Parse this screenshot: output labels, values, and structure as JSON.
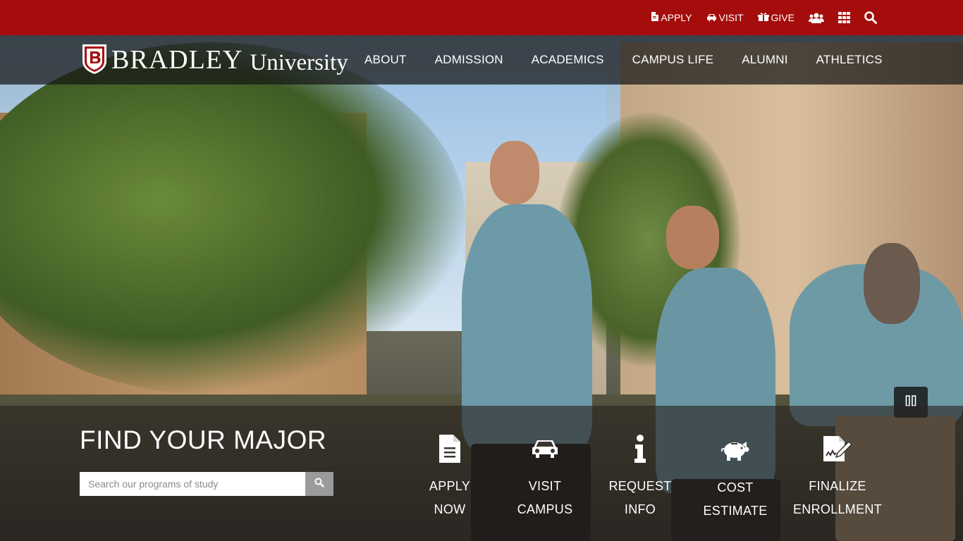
{
  "utility_bar": {
    "links": [
      {
        "label": "APPLY",
        "icon": "file-icon"
      },
      {
        "label": "VISIT",
        "icon": "car-icon"
      },
      {
        "label": "GIVE",
        "icon": "gift-icon"
      }
    ],
    "icons": [
      "users-icon",
      "grid-icon",
      "search-icon"
    ],
    "color": "#a50c0c"
  },
  "nav": {
    "logo_word": "BRADLEY",
    "logo_sub": "University",
    "items": [
      "ABOUT",
      "ADMISSION",
      "ACADEMICS",
      "CAMPUS LIFE",
      "ALUMNI",
      "ATHLETICS"
    ]
  },
  "hero": {
    "media_control": "pause-icon"
  },
  "find_major": {
    "title": "FIND YOUR MAJOR",
    "placeholder": "Search our programs of study",
    "value": ""
  },
  "actions": [
    {
      "line1": "APPLY",
      "line2": "NOW",
      "icon": "document-icon"
    },
    {
      "line1": "VISIT",
      "line2": "CAMPUS",
      "icon": "car-icon"
    },
    {
      "line1": "REQUEST",
      "line2": "INFO",
      "icon": "info-icon"
    },
    {
      "line1": "COST",
      "line2": "ESTIMATE",
      "icon": "piggy-bank-icon"
    },
    {
      "line1": "FINALIZE",
      "line2": "ENROLLMENT",
      "icon": "signature-icon"
    }
  ]
}
